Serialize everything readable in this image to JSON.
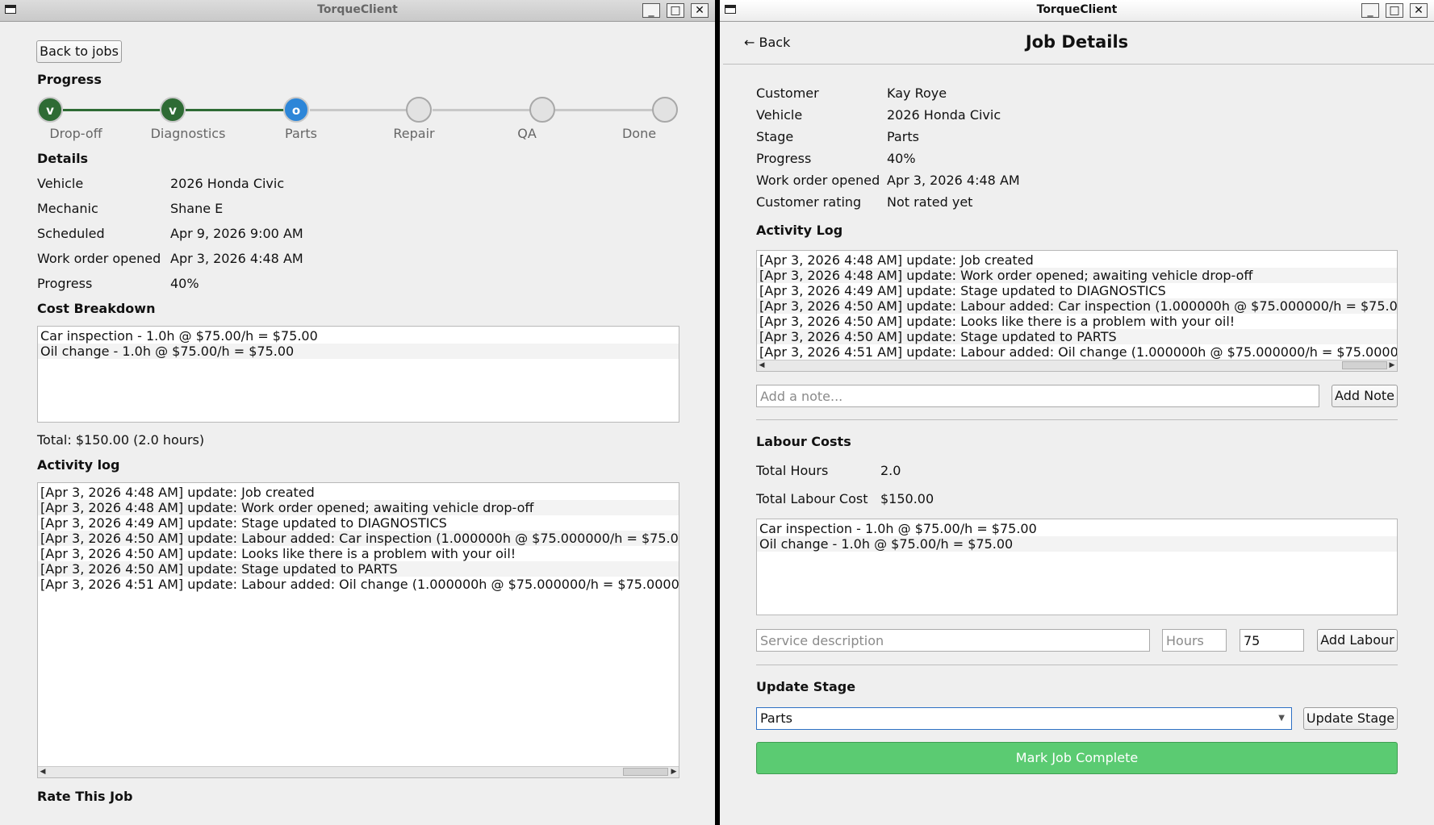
{
  "left_window": {
    "title": "TorqueClient",
    "back_label": "Back to jobs",
    "progress_heading": "Progress",
    "steps": [
      {
        "label": "Drop-off",
        "mark": "v",
        "state": "done"
      },
      {
        "label": "Diagnostics",
        "mark": "v",
        "state": "done"
      },
      {
        "label": "Parts",
        "mark": "o",
        "state": "current"
      },
      {
        "label": "Repair",
        "mark": "",
        "state": "todo"
      },
      {
        "label": "QA",
        "mark": "",
        "state": "todo"
      },
      {
        "label": "Done",
        "mark": "",
        "state": "todo"
      }
    ],
    "details_heading": "Details",
    "details": [
      {
        "label": "Vehicle",
        "value": "2026 Honda Civic"
      },
      {
        "label": "Mechanic",
        "value": "Shane E"
      },
      {
        "label": "Scheduled",
        "value": "Apr 9, 2026 9:00 AM"
      },
      {
        "label": "Work order opened",
        "value": "Apr 3, 2026 4:48 AM"
      },
      {
        "label": "Progress",
        "value": "40%"
      }
    ],
    "cost_heading": "Cost Breakdown",
    "cost_items": [
      "Car inspection - 1.0h @ $75.00/h = $75.00",
      "Oil change - 1.0h @ $75.00/h = $75.00"
    ],
    "total": "Total: $150.00 (2.0 hours)",
    "activity_heading": "Activity log",
    "activity": [
      "[Apr 3, 2026 4:48 AM] update: Job created",
      "[Apr 3, 2026 4:48 AM] update: Work order opened; awaiting vehicle drop-off",
      "[Apr 3, 2026 4:49 AM] update: Stage updated to DIAGNOSTICS",
      "[Apr 3, 2026 4:50 AM] update: Labour added: Car inspection (1.000000h @ $75.000000/h = $75.0",
      "[Apr 3, 2026 4:50 AM] update: Looks like there is a problem with your oil!",
      "[Apr 3, 2026 4:50 AM] update: Stage updated to PARTS",
      "[Apr 3, 2026 4:51 AM] update: Labour added: Oil change (1.000000h @ $75.000000/h = $75.0000"
    ],
    "rate_heading": "Rate This Job"
  },
  "right_window": {
    "title": "TorqueClient",
    "back_label": "← Back",
    "page_title": "Job Details",
    "details": [
      {
        "label": "Customer",
        "value": "Kay Roye"
      },
      {
        "label": "Vehicle",
        "value": "2026 Honda Civic"
      },
      {
        "label": "Stage",
        "value": "Parts"
      },
      {
        "label": "Progress",
        "value": "40%"
      },
      {
        "label": "Work order opened",
        "value": "Apr 3, 2026 4:48 AM"
      },
      {
        "label": "Customer rating",
        "value": "Not rated yet"
      }
    ],
    "activity_heading": "Activity Log",
    "activity": [
      "[Apr 3, 2026 4:48 AM] update: Job created",
      "[Apr 3, 2026 4:48 AM] update: Work order opened; awaiting vehicle drop-off",
      "[Apr 3, 2026 4:49 AM] update: Stage updated to DIAGNOSTICS",
      "[Apr 3, 2026 4:50 AM] update: Labour added: Car inspection (1.000000h @ $75.000000/h = $75.0",
      "[Apr 3, 2026 4:50 AM] update: Looks like there is a problem with your oil!",
      "[Apr 3, 2026 4:50 AM] update: Stage updated to PARTS",
      "[Apr 3, 2026 4:51 AM] update: Labour added: Oil change (1.000000h @ $75.000000/h = $75.0000"
    ],
    "note_placeholder": "Add a note...",
    "add_note_label": "Add Note",
    "labour_heading": "Labour Costs",
    "total_hours_label": "Total Hours",
    "total_hours_value": "2.0",
    "total_cost_label": "Total Labour Cost",
    "total_cost_value": "$150.00",
    "labour_items": [
      "Car inspection - 1.0h @ $75.00/h = $75.00",
      "Oil change - 1.0h @ $75.00/h = $75.00"
    ],
    "service_placeholder": "Service description",
    "hours_placeholder": "Hours",
    "rate_value": "75",
    "add_labour_label": "Add Labour",
    "update_stage_heading": "Update Stage",
    "stage_selected": "Parts",
    "update_stage_label": "Update Stage",
    "complete_label": "Mark Job Complete"
  },
  "colors": {
    "step_done": "#2e6b34",
    "step_current": "#2d86d8",
    "complete_button": "#5bcb72"
  }
}
